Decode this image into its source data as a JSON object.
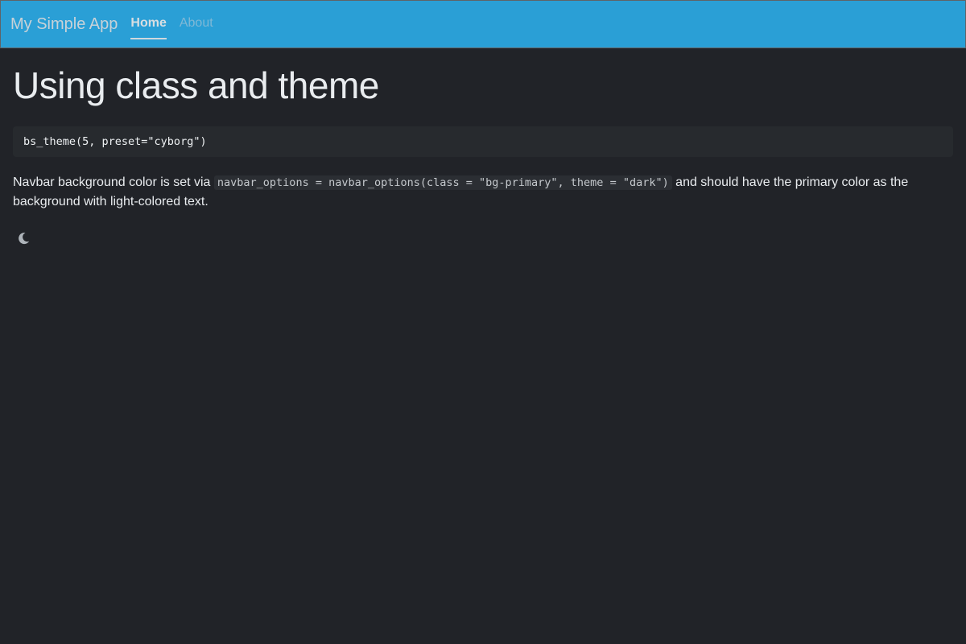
{
  "navbar": {
    "brand": "My Simple App",
    "links": [
      {
        "label": "Home",
        "active": true
      },
      {
        "label": "About",
        "active": false
      }
    ],
    "background_color": "#2a9fd6"
  },
  "main": {
    "title": "Using class and theme",
    "code_block": "bs_theme(5, preset=\"cyborg\")",
    "paragraph": {
      "text_before": "Navbar background color is set via ",
      "inline_code": "navbar_options = navbar_options(class = \"bg-primary\", theme = \"dark\")",
      "text_after": " and should have the primary color as the background with light-colored text."
    },
    "theme_toggle_icon": "moon-icon"
  },
  "colors": {
    "page_background": "#212328",
    "primary": "#2a9fd6"
  }
}
